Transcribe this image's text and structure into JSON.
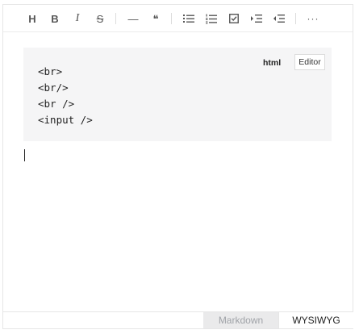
{
  "toolbar": {
    "heading_glyph": "H",
    "bold_glyph": "B",
    "italic_glyph": "I",
    "strike_glyph": "S",
    "hr_glyph": "—",
    "quote_glyph": "❝",
    "more_glyph": "···"
  },
  "code_block": {
    "language": "html",
    "editor_button": "Editor",
    "lines": [
      "<br>",
      "<br/>",
      "<br />",
      "<input />"
    ]
  },
  "modes": {
    "markdown": "Markdown",
    "wysiwyg": "WYSIWYG",
    "active": "WYSIWYG"
  }
}
